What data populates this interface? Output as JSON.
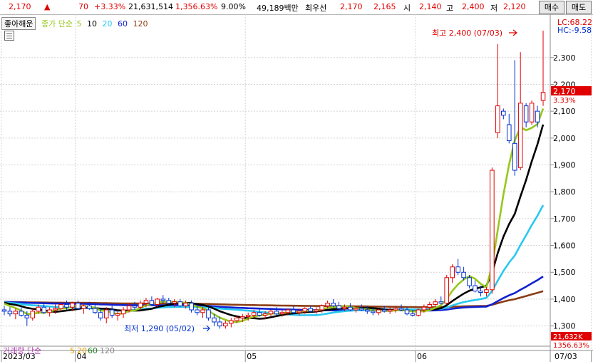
{
  "header": {
    "price": "2,170",
    "up_arrow": "▲",
    "change": "70",
    "change_pct": "+3.33%",
    "volume": "21,631,514",
    "volume_ratio": "1,356.63%",
    "turnover": "9.00%",
    "amount": "49,189백만",
    "best_bid_label": "최우선",
    "best_ask": "2,170",
    "best_bid": "2,165",
    "open_label": "시",
    "open": "2,140",
    "high_label": "고",
    "high": "2,400",
    "low_label": "저",
    "low": "2,120",
    "buy_button": "매수",
    "sell_button": "매도"
  },
  "legend": {
    "stock_name": "좋아해운",
    "ma_title": "종가 단순",
    "ma5": "5",
    "ma10": "10",
    "ma20": "20",
    "ma60": "60",
    "ma120": "120"
  },
  "volume_legend": {
    "title": "거래량 단순",
    "ma5": "5",
    "ma20": "20",
    "ma60": "60",
    "ma120": "120"
  },
  "annotations": {
    "max_label": "최고 2,400 (07/03)",
    "min_label": "최저 1,290 (05/02)",
    "lc": "LC:68.22",
    "hc": "HC:-9.58",
    "last_price_tag": "2,170",
    "last_pct": "3.33%",
    "volume_tag": "21,632K",
    "volume_pct": "1356.63%"
  },
  "colors": {
    "up": "#e00000",
    "down": "#0030d0",
    "ma5": "#96c81e",
    "ma10": "#000000",
    "ma20": "#28c8f0",
    "ma60": "#1020d0",
    "ma120": "#8b3c14"
  },
  "chart_data": {
    "type": "candlestick",
    "y_ticks": [
      1300,
      1400,
      1500,
      1600,
      1700,
      1800,
      1900,
      2000,
      2100,
      2200,
      2300
    ],
    "y_tick_labels": [
      "1,300",
      "1,400",
      "1,500",
      "1,600",
      "1,700",
      "1,800",
      "1,900",
      "2,000",
      "2,100",
      "2,200",
      "2,300"
    ],
    "ylim": [
      1230,
      2440
    ],
    "x_labels": [
      {
        "label": "2023/03",
        "index": 0
      },
      {
        "label": "04",
        "index": 13
      },
      {
        "label": "05",
        "index": 43
      },
      {
        "label": "06",
        "index": 73
      },
      {
        "label": "07",
        "index": 104
      }
    ],
    "date_box": "07/03",
    "candles": [
      {
        "o": 1360,
        "h": 1375,
        "l": 1340,
        "c": 1355
      },
      {
        "o": 1355,
        "h": 1370,
        "l": 1335,
        "c": 1345
      },
      {
        "o": 1345,
        "h": 1365,
        "l": 1325,
        "c": 1355
      },
      {
        "o": 1355,
        "h": 1370,
        "l": 1335,
        "c": 1340
      },
      {
        "o": 1340,
        "h": 1355,
        "l": 1300,
        "c": 1330
      },
      {
        "o": 1330,
        "h": 1365,
        "l": 1320,
        "c": 1355
      },
      {
        "o": 1355,
        "h": 1380,
        "l": 1345,
        "c": 1370
      },
      {
        "o": 1370,
        "h": 1385,
        "l": 1345,
        "c": 1350
      },
      {
        "o": 1350,
        "h": 1370,
        "l": 1335,
        "c": 1360
      },
      {
        "o": 1360,
        "h": 1380,
        "l": 1345,
        "c": 1365
      },
      {
        "o": 1365,
        "h": 1390,
        "l": 1355,
        "c": 1380
      },
      {
        "o": 1380,
        "h": 1395,
        "l": 1360,
        "c": 1370
      },
      {
        "o": 1370,
        "h": 1390,
        "l": 1355,
        "c": 1385
      },
      {
        "o": 1385,
        "h": 1395,
        "l": 1360,
        "c": 1365
      },
      {
        "o": 1365,
        "h": 1385,
        "l": 1345,
        "c": 1375
      },
      {
        "o": 1375,
        "h": 1390,
        "l": 1360,
        "c": 1365
      },
      {
        "o": 1365,
        "h": 1380,
        "l": 1345,
        "c": 1350
      },
      {
        "o": 1350,
        "h": 1365,
        "l": 1320,
        "c": 1330
      },
      {
        "o": 1330,
        "h": 1370,
        "l": 1310,
        "c": 1360
      },
      {
        "o": 1360,
        "h": 1375,
        "l": 1330,
        "c": 1340
      },
      {
        "o": 1340,
        "h": 1360,
        "l": 1320,
        "c": 1345
      },
      {
        "o": 1345,
        "h": 1370,
        "l": 1330,
        "c": 1360
      },
      {
        "o": 1360,
        "h": 1385,
        "l": 1350,
        "c": 1375
      },
      {
        "o": 1375,
        "h": 1390,
        "l": 1360,
        "c": 1370
      },
      {
        "o": 1370,
        "h": 1395,
        "l": 1360,
        "c": 1385
      },
      {
        "o": 1385,
        "h": 1405,
        "l": 1370,
        "c": 1395
      },
      {
        "o": 1395,
        "h": 1410,
        "l": 1375,
        "c": 1380
      },
      {
        "o": 1380,
        "h": 1405,
        "l": 1370,
        "c": 1400
      },
      {
        "o": 1400,
        "h": 1415,
        "l": 1385,
        "c": 1395
      },
      {
        "o": 1395,
        "h": 1405,
        "l": 1380,
        "c": 1385
      },
      {
        "o": 1385,
        "h": 1400,
        "l": 1370,
        "c": 1390
      },
      {
        "o": 1390,
        "h": 1400,
        "l": 1370,
        "c": 1375
      },
      {
        "o": 1375,
        "h": 1395,
        "l": 1365,
        "c": 1385
      },
      {
        "o": 1385,
        "h": 1395,
        "l": 1350,
        "c": 1360
      },
      {
        "o": 1360,
        "h": 1375,
        "l": 1340,
        "c": 1350
      },
      {
        "o": 1350,
        "h": 1370,
        "l": 1330,
        "c": 1360
      },
      {
        "o": 1360,
        "h": 1370,
        "l": 1320,
        "c": 1330
      },
      {
        "o": 1330,
        "h": 1345,
        "l": 1300,
        "c": 1315
      },
      {
        "o": 1315,
        "h": 1335,
        "l": 1290,
        "c": 1300
      },
      {
        "o": 1300,
        "h": 1320,
        "l": 1290,
        "c": 1310
      },
      {
        "o": 1310,
        "h": 1330,
        "l": 1295,
        "c": 1320
      },
      {
        "o": 1320,
        "h": 1340,
        "l": 1310,
        "c": 1330
      },
      {
        "o": 1330,
        "h": 1345,
        "l": 1315,
        "c": 1335
      },
      {
        "o": 1335,
        "h": 1350,
        "l": 1320,
        "c": 1340
      },
      {
        "o": 1340,
        "h": 1360,
        "l": 1330,
        "c": 1350
      },
      {
        "o": 1350,
        "h": 1365,
        "l": 1335,
        "c": 1340
      },
      {
        "o": 1340,
        "h": 1355,
        "l": 1325,
        "c": 1345
      },
      {
        "o": 1345,
        "h": 1360,
        "l": 1335,
        "c": 1355
      },
      {
        "o": 1355,
        "h": 1370,
        "l": 1340,
        "c": 1345
      },
      {
        "o": 1345,
        "h": 1360,
        "l": 1335,
        "c": 1350
      },
      {
        "o": 1350,
        "h": 1365,
        "l": 1340,
        "c": 1360
      },
      {
        "o": 1360,
        "h": 1375,
        "l": 1345,
        "c": 1350
      },
      {
        "o": 1350,
        "h": 1365,
        "l": 1340,
        "c": 1355
      },
      {
        "o": 1355,
        "h": 1370,
        "l": 1345,
        "c": 1365
      },
      {
        "o": 1365,
        "h": 1375,
        "l": 1350,
        "c": 1355
      },
      {
        "o": 1355,
        "h": 1370,
        "l": 1345,
        "c": 1360
      },
      {
        "o": 1360,
        "h": 1380,
        "l": 1350,
        "c": 1375
      },
      {
        "o": 1375,
        "h": 1395,
        "l": 1365,
        "c": 1385
      },
      {
        "o": 1385,
        "h": 1400,
        "l": 1370,
        "c": 1375
      },
      {
        "o": 1375,
        "h": 1390,
        "l": 1360,
        "c": 1365
      },
      {
        "o": 1365,
        "h": 1380,
        "l": 1355,
        "c": 1370
      },
      {
        "o": 1370,
        "h": 1385,
        "l": 1355,
        "c": 1360
      },
      {
        "o": 1360,
        "h": 1375,
        "l": 1350,
        "c": 1365
      },
      {
        "o": 1365,
        "h": 1380,
        "l": 1355,
        "c": 1360
      },
      {
        "o": 1360,
        "h": 1375,
        "l": 1345,
        "c": 1355
      },
      {
        "o": 1355,
        "h": 1370,
        "l": 1340,
        "c": 1350
      },
      {
        "o": 1350,
        "h": 1365,
        "l": 1340,
        "c": 1360
      },
      {
        "o": 1360,
        "h": 1375,
        "l": 1350,
        "c": 1355
      },
      {
        "o": 1355,
        "h": 1370,
        "l": 1345,
        "c": 1360
      },
      {
        "o": 1360,
        "h": 1375,
        "l": 1350,
        "c": 1365
      },
      {
        "o": 1365,
        "h": 1380,
        "l": 1355,
        "c": 1360
      },
      {
        "o": 1360,
        "h": 1370,
        "l": 1340,
        "c": 1345
      },
      {
        "o": 1345,
        "h": 1360,
        "l": 1335,
        "c": 1340
      },
      {
        "o": 1340,
        "h": 1365,
        "l": 1335,
        "c": 1360
      },
      {
        "o": 1360,
        "h": 1380,
        "l": 1350,
        "c": 1370
      },
      {
        "o": 1370,
        "h": 1390,
        "l": 1360,
        "c": 1380
      },
      {
        "o": 1380,
        "h": 1400,
        "l": 1370,
        "c": 1390
      },
      {
        "o": 1390,
        "h": 1410,
        "l": 1380,
        "c": 1385
      },
      {
        "o": 1385,
        "h": 1490,
        "l": 1380,
        "c": 1480
      },
      {
        "o": 1480,
        "h": 1530,
        "l": 1460,
        "c": 1520
      },
      {
        "o": 1520,
        "h": 1550,
        "l": 1490,
        "c": 1500
      },
      {
        "o": 1500,
        "h": 1520,
        "l": 1470,
        "c": 1480
      },
      {
        "o": 1480,
        "h": 1490,
        "l": 1440,
        "c": 1450
      },
      {
        "o": 1450,
        "h": 1470,
        "l": 1425,
        "c": 1430
      },
      {
        "o": 1430,
        "h": 1450,
        "l": 1410,
        "c": 1425
      },
      {
        "o": 1425,
        "h": 1445,
        "l": 1410,
        "c": 1435
      },
      {
        "o": 1435,
        "h": 1890,
        "l": 1420,
        "c": 1880
      },
      {
        "o": 2020,
        "h": 2350,
        "l": 2000,
        "c": 2120
      },
      {
        "o": 2100,
        "h": 2110,
        "l": 2070,
        "c": 2085
      },
      {
        "o": 2050,
        "h": 2090,
        "l": 1980,
        "c": 1990
      },
      {
        "o": 1980,
        "h": 2290,
        "l": 1860,
        "c": 1880
      },
      {
        "o": 1890,
        "h": 2320,
        "l": 1880,
        "c": 2130
      },
      {
        "o": 2120,
        "h": 2130,
        "l": 2040,
        "c": 2060
      },
      {
        "o": 2060,
        "h": 2140,
        "l": 2050,
        "c": 2130
      },
      {
        "o": 2100,
        "h": 2120,
        "l": 2040,
        "c": 2060
      },
      {
        "o": 2140,
        "h": 2400,
        "l": 2120,
        "c": 2170
      }
    ]
  }
}
